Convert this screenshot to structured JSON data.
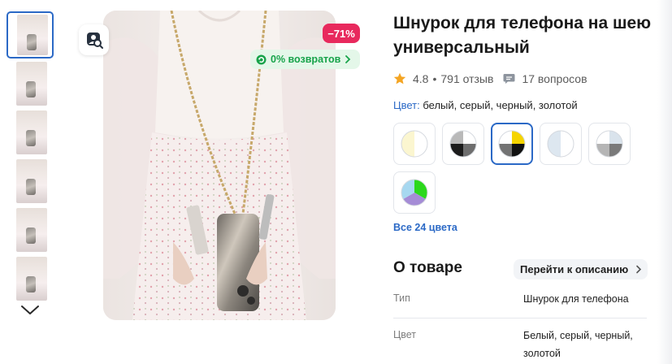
{
  "product": {
    "title": "Шнурок для телефона на шею универсальный",
    "rating": "4.8",
    "reviews": "791 отзыв",
    "questions": "17 вопросов",
    "discount_badge": "−71%",
    "returns_badge": "0% возвратов"
  },
  "colors": {
    "label": "Цвет:",
    "value": "белый, серый, черный, золотой",
    "all_link": "Все 24 цвета",
    "swatches": [
      {
        "name": "white-cream",
        "colors": [
          "#ffffff",
          "#fbf6d0"
        ]
      },
      {
        "name": "white-gray-black",
        "colors": [
          "#ffffff",
          "#6e6e6e",
          "#1c1c1c",
          "#b9b9b9"
        ]
      },
      {
        "name": "yellow-black-gray",
        "colors": [
          "#f5d400",
          "#111111",
          "#737373",
          "#ffffff"
        ],
        "selected": true
      },
      {
        "name": "light-blue",
        "colors": [
          "#ffffff",
          "#dde7f0"
        ]
      },
      {
        "name": "gray-blue",
        "colors": [
          "#d9e3ec",
          "#7a7a7a",
          "#b5b5b5",
          "#ffffff"
        ]
      },
      {
        "name": "green-lilac-blue",
        "colors": [
          "#2bd81c",
          "#a58cd6",
          "#a7d8f0"
        ]
      }
    ]
  },
  "about": {
    "heading": "О товаре",
    "goto_label": "Перейти к описанию",
    "specs": [
      {
        "key": "Тип",
        "value": "Шнурок для телефона"
      },
      {
        "key": "Цвет",
        "value": "Белый, серый, черный,",
        "value2": "золотой"
      }
    ]
  },
  "icons": {
    "thumbs_down": "chevron-down-icon",
    "photo_search": "image-search-icon",
    "returns": "return-arrow-icon",
    "star": "star-icon",
    "questions": "chat-bubble-icon",
    "goto": "chevron-right-icon"
  },
  "accent": "#2b69c6",
  "discount_color": "#e8295d",
  "returns_color": "#17a34a",
  "star_color": "#f4a523"
}
